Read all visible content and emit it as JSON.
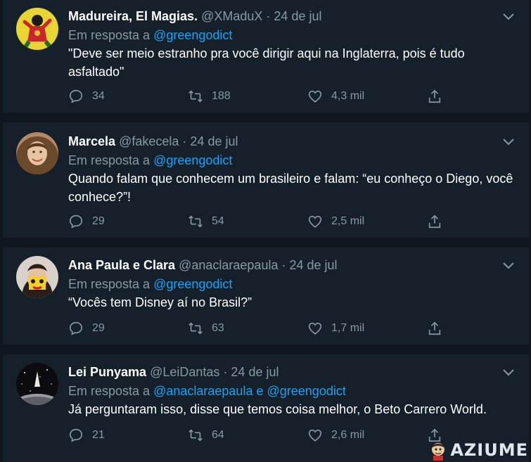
{
  "tweets": [
    {
      "name": "Madureira, El Magias.",
      "handle": "@XMaduX",
      "separator": "·",
      "date": "24 de jul",
      "reply_prefix": "Em resposta a",
      "reply_to_1": "@greengodict",
      "reply_joiner": "",
      "reply_to_2": "",
      "text": "\"Deve ser meio estranho pra você dirigir aqui na Inglaterra, pois é tudo asfaltado\"",
      "replies": "34",
      "retweets": "188",
      "likes": "4,3 mil"
    },
    {
      "name": "Marcela",
      "handle": "@fakecela",
      "separator": "·",
      "date": "24 de jul",
      "reply_prefix": "Em resposta a",
      "reply_to_1": "@greengodict",
      "reply_joiner": "",
      "reply_to_2": "",
      "text": "Quando falam que conhecem um brasileiro e falam: “eu conheço o Diego, você conhece?”!",
      "replies": "29",
      "retweets": "54",
      "likes": "2,5 mil"
    },
    {
      "name": "Ana Paula e Clara",
      "handle": "@anaclaraepaula",
      "separator": "·",
      "date": "24 de jul",
      "reply_prefix": "Em resposta a",
      "reply_to_1": "@greengodict",
      "reply_joiner": "",
      "reply_to_2": "",
      "text": "“Vocês tem Disney aí no Brasil?”",
      "replies": "29",
      "retweets": "63",
      "likes": "1,7 mil"
    },
    {
      "name": "Lei Punyama",
      "handle": "@LeiDantas",
      "separator": "·",
      "date": "24 de jul",
      "reply_prefix": "Em resposta a",
      "reply_to_1": "@anaclaraepaula",
      "reply_joiner": "e",
      "reply_to_2": "@greengodict",
      "text": "Já perguntaram isso, disse que temos coisa melhor, o Beto Carrero World.",
      "replies": "21",
      "retweets": "64",
      "likes": "2,6 mil"
    }
  ],
  "watermark": {
    "text": "AZIUME"
  },
  "colors": {
    "background": "#15202b",
    "separator": "#10171e",
    "text": "#ffffff",
    "muted": "#8899a6",
    "link": "#1da1f2"
  },
  "icons": [
    "chevron-down-icon",
    "reply-icon",
    "retweet-icon",
    "like-icon",
    "share-icon"
  ]
}
